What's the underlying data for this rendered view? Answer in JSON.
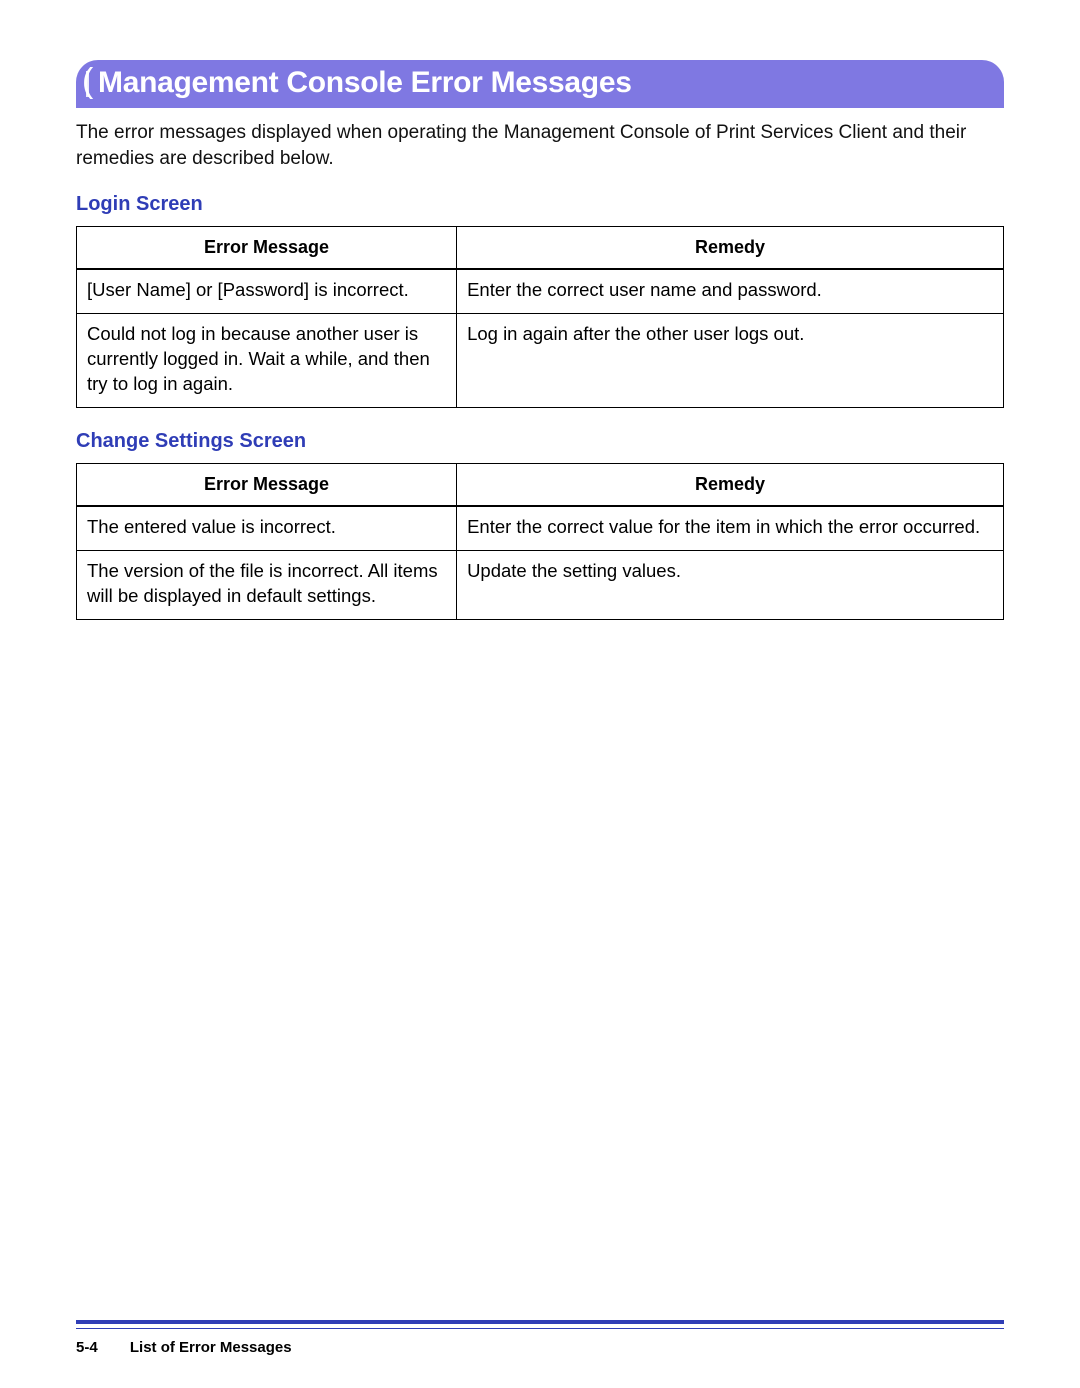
{
  "banner_title": "Management Console Error Messages",
  "intro_text": "The error messages displayed when operating the Management Console of Print Services Client and their remedies are described below.",
  "sections": [
    {
      "heading": "Login Screen",
      "headers": {
        "col1": "Error Message",
        "col2": "Remedy"
      },
      "rows": [
        {
          "msg": "[User Name] or [Password] is incorrect.",
          "remedy": "Enter the correct user name and password."
        },
        {
          "msg": "Could not log in because another user is currently logged in. Wait a while, and then try to log in again.",
          "remedy": "Log in again after the other user logs out."
        }
      ]
    },
    {
      "heading": "Change Settings Screen",
      "headers": {
        "col1": "Error Message",
        "col2": "Remedy"
      },
      "rows": [
        {
          "msg": "The entered value is incorrect.",
          "remedy": "Enter the correct value for the item in which the error occurred."
        },
        {
          "msg": "The version of the file is incorrect. All items will be displayed in default settings.",
          "remedy": "Update the setting values."
        }
      ]
    }
  ],
  "footer": {
    "page_number": "5-4",
    "chapter_title": "List of Error Messages"
  }
}
